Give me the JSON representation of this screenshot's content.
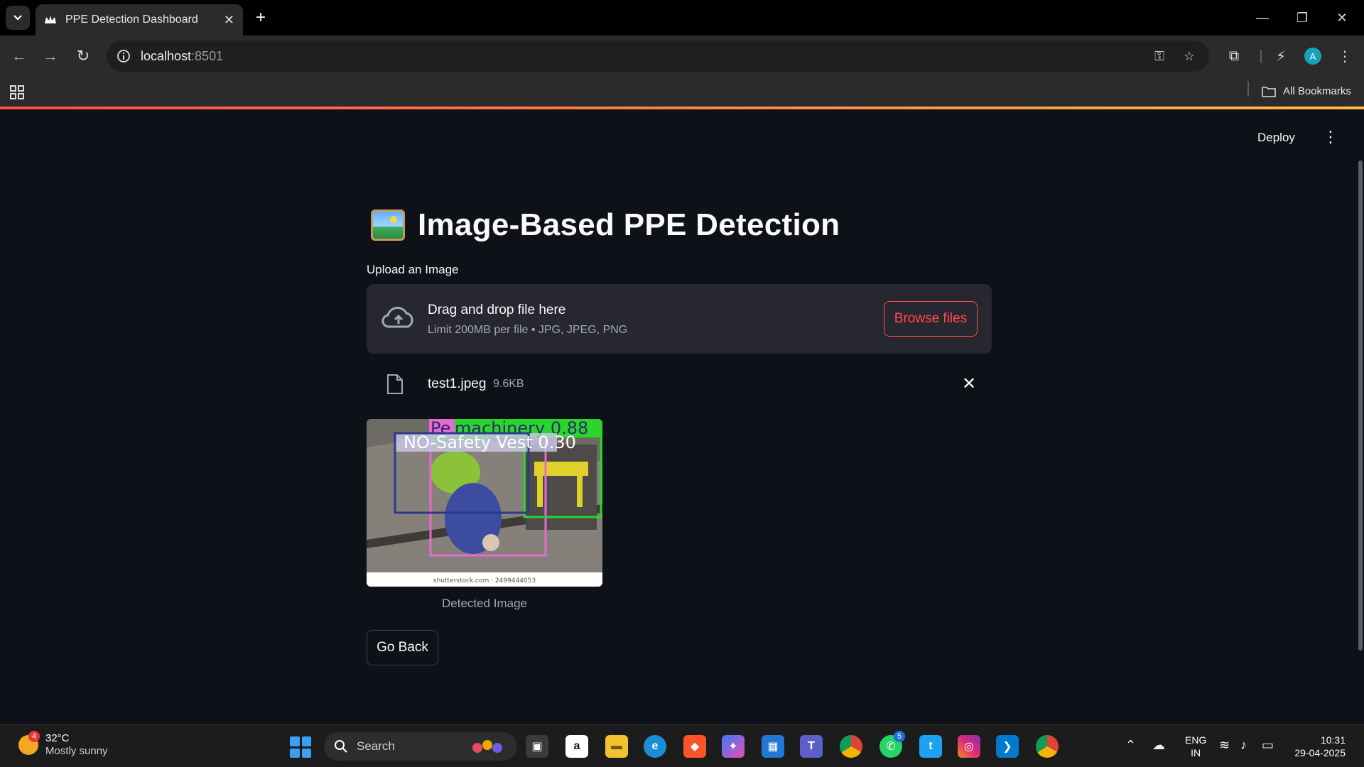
{
  "browser": {
    "tab_title": "PPE Detection Dashboard",
    "url_host": "localhost",
    "url_port": ":8501",
    "bookmarks_label": "All Bookmarks"
  },
  "app": {
    "deploy_label": "Deploy",
    "title": "Image-Based PPE Detection",
    "title_icon": "framed-picture-icon",
    "upload": {
      "label": "Upload an Image",
      "dropzone_title": "Drag and drop file here",
      "dropzone_limit": "Limit 200MB per file • JPG, JPEG, PNG",
      "browse_label": "Browse files"
    },
    "file": {
      "name": "test1.jpeg",
      "size": "9.6KB"
    },
    "detection": {
      "box_labels": [
        "Person",
        "machinery 0.88",
        "NO-Safety Vest 0.30"
      ],
      "watermark": "shutterstock.com · 2499444053",
      "caption": "Detected Image"
    },
    "go_back_label": "Go Back",
    "accent_color": "#ff4b4b"
  },
  "taskbar": {
    "weather_badge": "4",
    "weather_temp": "32°C",
    "weather_desc": "Mostly sunny",
    "search_placeholder": "Search",
    "whatsapp_badge": "5",
    "lang_top": "ENG",
    "lang_bottom": "IN",
    "time": "10:31",
    "date": "29-04-2025"
  }
}
